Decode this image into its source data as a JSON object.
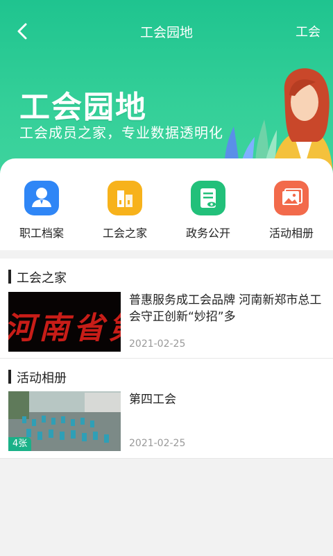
{
  "nav": {
    "title": "工会园地",
    "right_label": "工会"
  },
  "hero": {
    "title": "工会园地",
    "subtitle": "工会成员之家，专业数据透明化"
  },
  "menu": [
    {
      "label": "职工档案",
      "icon": "employee-profile-icon",
      "color": "#2f86f6"
    },
    {
      "label": "工会之家",
      "icon": "union-home-building-icon",
      "color": "#f7b21b"
    },
    {
      "label": "政务公开",
      "icon": "gov-document-icon",
      "color": "#22c07a"
    },
    {
      "label": "活动相册",
      "icon": "photo-album-icon",
      "color": "#f26a4b"
    }
  ],
  "sections": [
    {
      "title": "工会之家",
      "article": {
        "title": "普惠服务成工会品牌 河南新郑市总工会守正创新“妙招”多",
        "date": "2021-02-25",
        "thumb_text": "河南省第"
      }
    },
    {
      "title": "活动相册",
      "article": {
        "title": "第四工会",
        "date": "2021-02-25",
        "badge": "4张"
      }
    }
  ],
  "colors": {
    "brand": "#1fc48f",
    "badge": "#1ab188"
  }
}
